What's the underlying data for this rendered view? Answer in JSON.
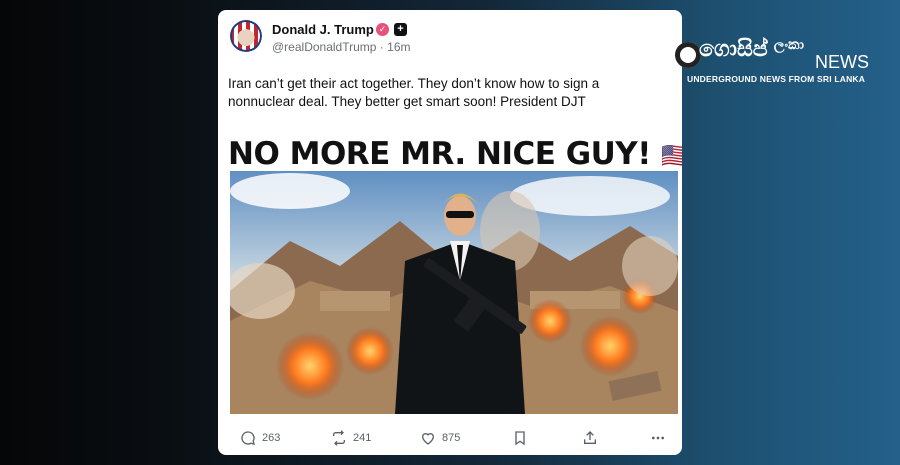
{
  "post": {
    "author_name": "Donald J. Trump",
    "handle": "@realDonaldTrump",
    "time": "16m",
    "text": "Iran can’t get their act together. They don’t know how to sign a nonnuclear deal. They better get smart soon! President DJT",
    "media_title": "NO MORE MR. NICE GUY!",
    "media_title_emoji": "🇺🇸"
  },
  "actions": {
    "replies": "263",
    "reposts": "241",
    "likes": "875"
  },
  "watermark": {
    "title": "ගොසිප්",
    "suffix": "ලංකා",
    "news": "NEWS",
    "tagline": "UNDERGROUND NEWS FROM SRI LANKA"
  },
  "colors": {
    "verified_badge": "#e8527a",
    "text_primary": "#111111",
    "text_secondary": "#6b6f75"
  }
}
